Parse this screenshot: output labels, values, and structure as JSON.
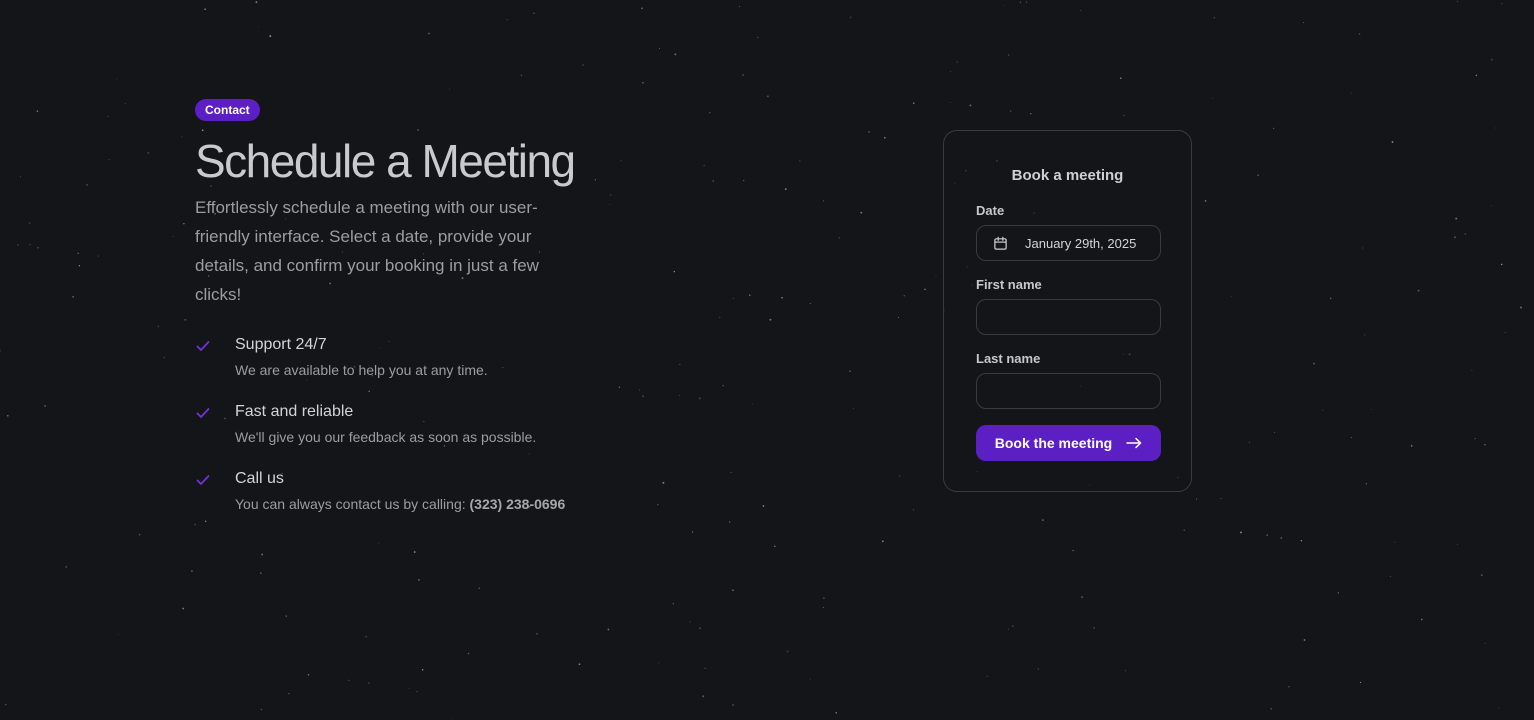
{
  "badge": "Contact",
  "title": "Schedule a Meeting",
  "description": "Effortlessly schedule a meeting with our user-friendly interface. Select a date, provide your details, and confirm your booking in just a few clicks!",
  "features": [
    {
      "title": "Support 24/7",
      "description": "We are available to help you at any time."
    },
    {
      "title": "Fast and reliable",
      "description": "We'll give you our feedback as soon as possible."
    },
    {
      "title": "Call us",
      "description": "You can always contact us by calling: ",
      "phone": "(323) 238-0696"
    }
  ],
  "form": {
    "title": "Book a meeting",
    "date_label": "Date",
    "date_value": "January 29th, 2025",
    "first_name_label": "First name",
    "first_name_value": "",
    "last_name_label": "Last name",
    "last_name_value": "",
    "submit_label": "Book the meeting"
  },
  "icons": {
    "check": "check-icon",
    "calendar": "calendar-icon",
    "arrow": "arrow-right-icon"
  },
  "colors": {
    "background": "#141519",
    "accent": "#5b1fc4",
    "check": "#6d35d6"
  }
}
